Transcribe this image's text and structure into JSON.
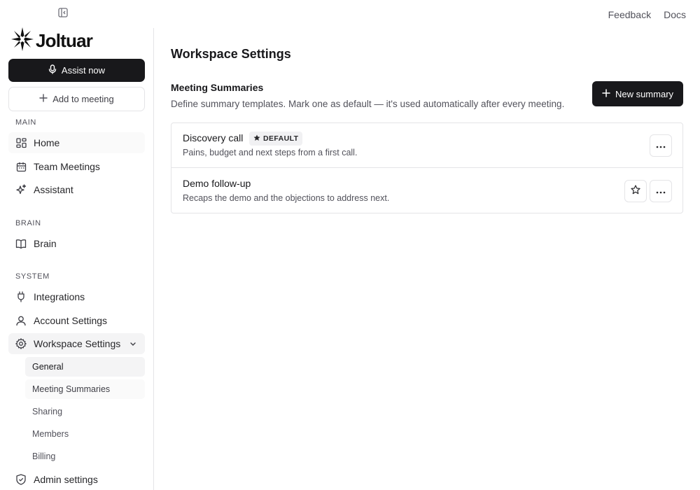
{
  "header": {
    "links": [
      "Feedback",
      "Docs"
    ]
  },
  "sidebar": {
    "brand": "Joltuar",
    "assist_label": "Assist now",
    "add_label": "Add to meeting",
    "sections": {
      "main": "MAIN",
      "brain": "BRAIN",
      "system": "SYSTEM"
    },
    "items": {
      "home": "Home",
      "team_meetings": "Team Meetings",
      "assistant": "Assistant",
      "brain": "Brain",
      "integrations": "Integrations",
      "account_settings": "Account Settings",
      "workspace_settings": "Workspace Settings",
      "admin_settings": "Admin settings"
    },
    "workspace_sub": [
      "General",
      "Meeting Summaries",
      "Sharing",
      "Members",
      "Billing"
    ]
  },
  "main": {
    "title": "Workspace Settings",
    "section_title": "Meeting Summaries",
    "section_desc": "Define summary templates. Mark one as default — it's used automatically after every meeting.",
    "new_button": "New summary",
    "default_badge": "DEFAULT",
    "templates": [
      {
        "name": "Discovery call",
        "desc": "Pains, budget and next steps from a first call.",
        "is_default": true
      },
      {
        "name": "Demo follow-up",
        "desc": "Recaps the demo and the objections to address next.",
        "is_default": false
      }
    ]
  },
  "colors": {
    "primary": "#18181b",
    "border": "#e4e4e7",
    "muted_text": "#52525b",
    "active_bg": "#f4f4f5"
  },
  "icons": [
    "sidebar-collapse-icon",
    "brand-logo-icon",
    "mic-icon",
    "plus-icon",
    "grid-icon",
    "calendar-icon",
    "sparkles-icon",
    "book-icon",
    "plug-icon",
    "user-icon",
    "gear-icon",
    "chevron-down-icon",
    "shield-icon",
    "star-icon",
    "more-icon"
  ]
}
